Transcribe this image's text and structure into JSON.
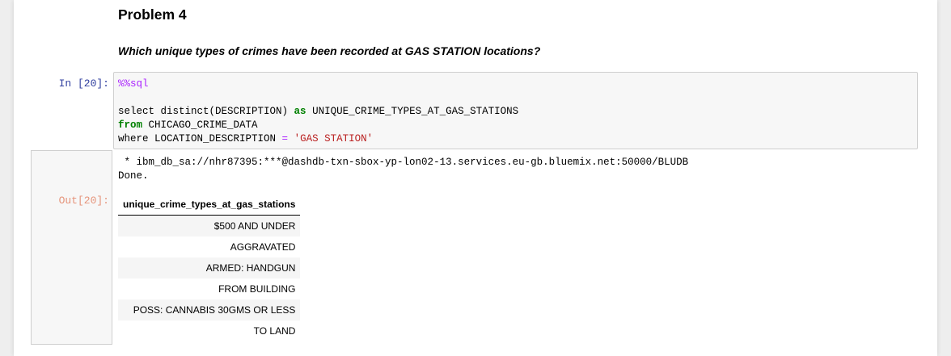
{
  "markdown": {
    "title": "Problem 4",
    "question": "Which unique types of crimes have been recorded at GAS STATION locations?"
  },
  "code_cell": {
    "prompt": "In [20]:",
    "magic": "%%sql",
    "line1_plain": "select distinct(DESCRIPTION) ",
    "line1_kw": "as",
    "line1_rest": " UNIQUE_CRIME_TYPES_AT_GAS_STATIONS",
    "line2_kw": "from",
    "line2_rest": " CHICAGO_CRIME_DATA",
    "line3_plain": "where LOCATION_DESCRIPTION ",
    "line3_op": "=",
    "line3_str": "'GAS STATION'"
  },
  "output": {
    "prompt": "Out[20]:",
    "connection": " * ibm_db_sa://nhr87395:***@dashdb-txn-sbox-yp-lon02-13.services.eu-gb.bluemix.net:50000/BLUDB",
    "status": "Done.",
    "table": {
      "header": "unique_crime_types_at_gas_stations",
      "rows": [
        "$500 AND UNDER",
        "AGGRAVATED",
        "ARMED: HANDGUN",
        "FROM BUILDING",
        "POSS: CANNABIS 30GMS OR LESS",
        "TO LAND"
      ]
    }
  },
  "colors": {
    "in_prompt": "#303f9f",
    "out_prompt": "#d84315",
    "keyword": "#008000",
    "magic": "#aa22ff",
    "string": "#ba2121"
  }
}
